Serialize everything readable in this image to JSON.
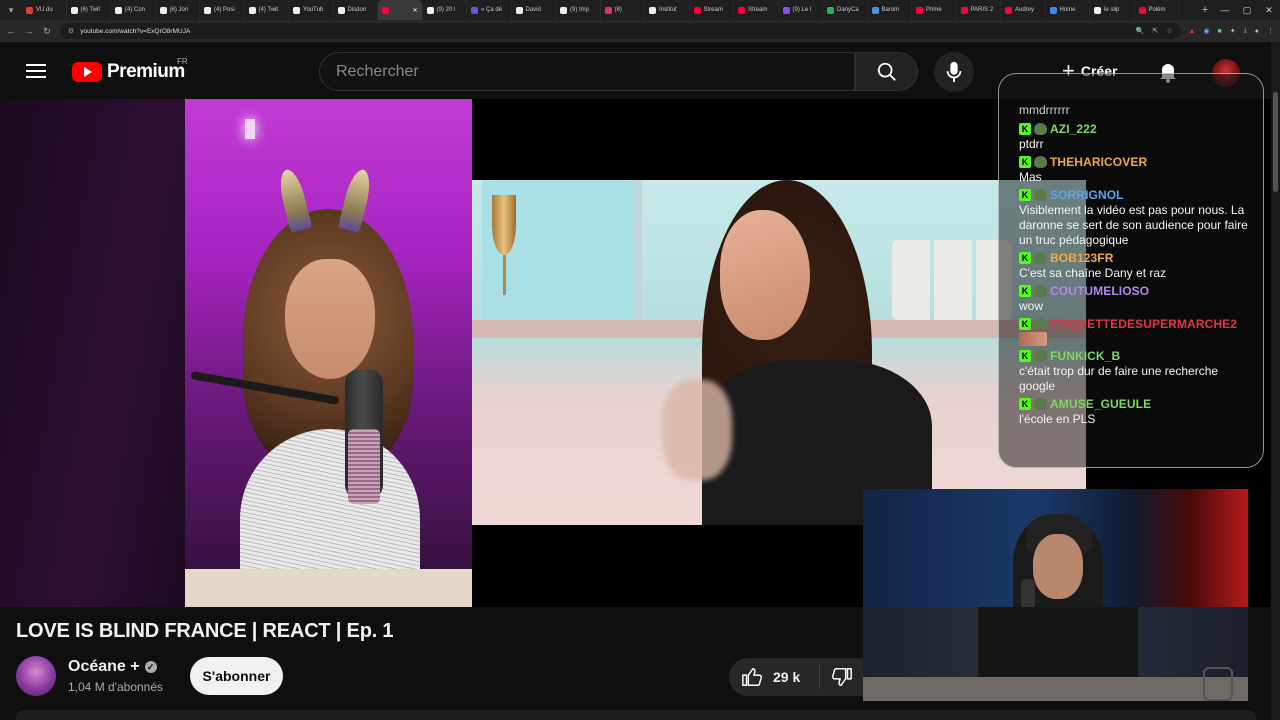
{
  "browser": {
    "tabs": [
      {
        "label": "VU du",
        "color": "#e53935"
      },
      {
        "label": "(6) Twit",
        "color": "#eeeeee"
      },
      {
        "label": "(4) Con",
        "color": "#eeeeee"
      },
      {
        "label": "(6) Jon",
        "color": "#eeeeee"
      },
      {
        "label": "(4) Posi",
        "color": "#eeeeee"
      },
      {
        "label": "(4) Twit",
        "color": "#eeeeee"
      },
      {
        "label": "YouTub",
        "color": "#eeeeee"
      },
      {
        "label": "Disdon",
        "color": "#eeeeee"
      },
      {
        "label": "",
        "color": "#ff0033",
        "active": true
      },
      {
        "label": "(9) 20 l",
        "color": "#eeeeee"
      },
      {
        "label": "« Ça dé",
        "color": "#5b5bd6"
      },
      {
        "label": "David",
        "color": "#eeeeee"
      },
      {
        "label": "(9) Imp",
        "color": "#eeeeee"
      },
      {
        "label": "(8)",
        "color": "#e1306c"
      },
      {
        "label": "Institut",
        "color": "#eeeeee"
      },
      {
        "label": "Stream",
        "color": "#ff0033"
      },
      {
        "label": "Stream",
        "color": "#ff0033"
      },
      {
        "label": "(9) Le l",
        "color": "#9146ff"
      },
      {
        "label": "DanyCa",
        "color": "#1db954"
      },
      {
        "label": "Barom",
        "color": "#4a90d9"
      },
      {
        "label": "Prime",
        "color": "#ff0033"
      },
      {
        "label": "PARIS 2",
        "color": "#ff0033"
      },
      {
        "label": "Audrey",
        "color": "#ff0033"
      },
      {
        "label": "Home",
        "color": "#4285f4"
      },
      {
        "label": "le slip",
        "color": "#eeeeee"
      },
      {
        "label": "Polém",
        "color": "#ff0033"
      }
    ],
    "new_tab_icon": "plus-icon",
    "url": "youtube.com/watch?v=ExQrO8rMUJA"
  },
  "header": {
    "logo_text": "Premium",
    "country_code": "FR",
    "search_placeholder": "Rechercher",
    "create_label": "Créer"
  },
  "chat": {
    "top_fragment": "mmdrrrrrr",
    "messages": [
      {
        "user": "AZI_222",
        "color": "#7cd962",
        "text": "ptdrr"
      },
      {
        "user": "THEHARICOVER",
        "color": "#f2a93b",
        "text": "Mas"
      },
      {
        "user": "SORRIGNOL",
        "color": "#5aa6f0",
        "text": "Visiblement la vidéo est pas pour nous. La daronne se sert de son audience pour faire un truc pédagogique"
      },
      {
        "user": "BOB123FR",
        "color": "#f2a93b",
        "text": "C'est sa chaîne Dany et raz"
      },
      {
        "user": "COUTUMELIOSO",
        "color": "#b487f0",
        "text": "wow"
      },
      {
        "user": "ETIQUETTEDESUPERMARCHE2",
        "color": "#e0344a",
        "text": ""
      },
      {
        "user": "FUNKICK_B",
        "color": "#7cd962",
        "text": "c'était trop dur de faire une recherche google"
      },
      {
        "user": "AMUSE_GUEULE",
        "color": "#7cd962",
        "text": "l'école en PLS"
      }
    ]
  },
  "video": {
    "title": "LOVE IS BLIND FRANCE | REACT | Ep. 1",
    "channel_name": "Océane +",
    "subscribers": "1,04 M d'abonnés",
    "subscribe_label": "S'abonner",
    "likes": "29 k"
  }
}
